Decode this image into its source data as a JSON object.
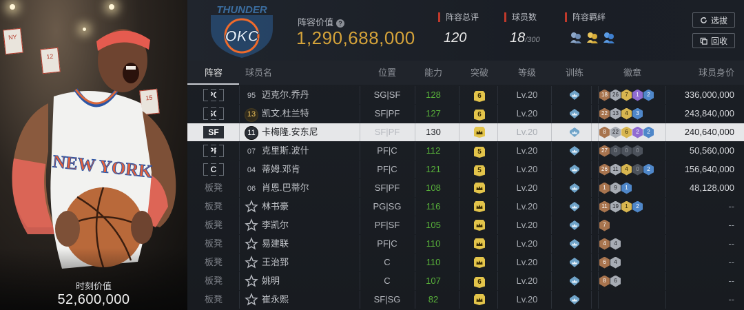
{
  "card": {
    "moment_label": "时刻价值",
    "moment_value": "52,600,000",
    "jersey_text": "NEW YORK"
  },
  "header": {
    "team_logo_text": "OKC",
    "team_logo_sub": "THUNDER",
    "lineup_value_label": "阵容价值",
    "lineup_value": "1,290,688,000",
    "rating_label": "阵容总评",
    "rating_value": "120",
    "players_label": "球员数",
    "players_value": "18",
    "players_max": "/300",
    "bond_label": "阵容羁绊",
    "select_button": "选拔",
    "recycle_button": "回收"
  },
  "columns": [
    "阵容",
    "球员名",
    "位置",
    "能力",
    "突破",
    "等级",
    "训练",
    "徽章",
    "球员身价"
  ],
  "rows": [
    {
      "slot": "PG",
      "num": "95",
      "num_style": "plain",
      "name": "迈克尔.乔丹",
      "pos": "SG|SF",
      "power": "128",
      "brk": "6",
      "lv": "Lv.20",
      "badges": [
        [
          "brown",
          "18"
        ],
        [
          "silver",
          "26"
        ],
        [
          "gold",
          "7"
        ],
        [
          "purple",
          "1"
        ],
        [
          "blue",
          "2"
        ]
      ],
      "price": "336,000,000"
    },
    {
      "slot": "SG",
      "num": "13",
      "num_style": "gold",
      "name": "凯文.杜兰特",
      "pos": "SF|PF",
      "power": "127",
      "brk": "6",
      "lv": "Lv.20",
      "badges": [
        [
          "brown",
          "22"
        ],
        [
          "silver",
          "13"
        ],
        [
          "gold",
          "4"
        ],
        [
          "blue",
          "3"
        ]
      ],
      "price": "243,840,000"
    },
    {
      "slot": "SF",
      "num": "11",
      "num_style": "dark",
      "name": "卡梅隆.安东尼",
      "pos": "SF|PF",
      "power": "130",
      "brk": "crown",
      "lv": "Lv.20",
      "badges": [
        [
          "brown",
          "8"
        ],
        [
          "silver",
          "22"
        ],
        [
          "gold",
          "6"
        ],
        [
          "purple",
          "2"
        ],
        [
          "blue",
          "2"
        ]
      ],
      "price": "240,640,000",
      "selected": true
    },
    {
      "slot": "PF",
      "num": "07",
      "num_style": "plain",
      "name": "克里斯.波什",
      "pos": "PF|C",
      "power": "112",
      "brk": "5",
      "lv": "Lv.20",
      "badges": [
        [
          "brown",
          "27"
        ],
        [
          "gray",
          "0"
        ],
        [
          "gray",
          "0"
        ],
        [
          "gray",
          "0"
        ]
      ],
      "price": "50,560,000"
    },
    {
      "slot": "C",
      "num": "04",
      "num_style": "plain",
      "name": "蒂姆.邓肯",
      "pos": "PF|C",
      "power": "121",
      "brk": "5",
      "lv": "Lv.20",
      "badges": [
        [
          "brown",
          "26"
        ],
        [
          "silver",
          "11"
        ],
        [
          "gold",
          "4"
        ],
        [
          "gray",
          "0"
        ],
        [
          "blue",
          "2"
        ]
      ],
      "price": "156,640,000"
    },
    {
      "slot": "板凳",
      "num": "06",
      "num_style": "plain",
      "name": "肖恩.巴蒂尔",
      "pos": "SF|PF",
      "power": "108",
      "brk": "crown",
      "lv": "Lv.20",
      "badges": [
        [
          "brown",
          "1"
        ],
        [
          "silver",
          "9"
        ],
        [
          "blue",
          "1"
        ]
      ],
      "price": "48,128,000"
    },
    {
      "slot": "板凳",
      "num": "",
      "num_style": "star",
      "name": "林书豪",
      "pos": "PG|SG",
      "power": "116",
      "brk": "crown",
      "lv": "Lv.20",
      "badges": [
        [
          "brown",
          "11"
        ],
        [
          "silver",
          "19"
        ],
        [
          "gold",
          "1"
        ],
        [
          "blue",
          "2"
        ]
      ],
      "price": "--"
    },
    {
      "slot": "板凳",
      "num": "",
      "num_style": "star",
      "name": "李凯尔",
      "pos": "PF|SF",
      "power": "105",
      "brk": "crown",
      "lv": "Lv.20",
      "badges": [
        [
          "brown",
          "7"
        ]
      ],
      "price": "--"
    },
    {
      "slot": "板凳",
      "num": "",
      "num_style": "star",
      "name": "易建联",
      "pos": "PF|C",
      "power": "110",
      "brk": "crown",
      "lv": "Lv.20",
      "badges": [
        [
          "brown",
          "4"
        ],
        [
          "silver",
          "4"
        ]
      ],
      "price": "--"
    },
    {
      "slot": "板凳",
      "num": "",
      "num_style": "star",
      "name": "王治郅",
      "pos": "C",
      "power": "110",
      "brk": "crown",
      "lv": "Lv.20",
      "badges": [
        [
          "brown",
          "6"
        ],
        [
          "silver",
          "4"
        ]
      ],
      "price": "--"
    },
    {
      "slot": "板凳",
      "num": "",
      "num_style": "star",
      "name": "姚明",
      "pos": "C",
      "power": "107",
      "brk": "6",
      "lv": "Lv.20",
      "badges": [
        [
          "brown",
          "8"
        ],
        [
          "silver",
          "6"
        ]
      ],
      "price": "--"
    },
    {
      "slot": "板凳",
      "num": "",
      "num_style": "star",
      "name": "崔永熙",
      "pos": "SF|SG",
      "power": "82",
      "brk": "crown",
      "lv": "Lv.20",
      "badges": [],
      "price": "--"
    }
  ],
  "colors": {
    "accent_gold": "#d5a33a",
    "power_green": "#58b13a",
    "marker_red": "#c0392b"
  },
  "icons": [
    "help-icon",
    "bond-icon",
    "refresh-icon",
    "recycle-icon",
    "star-icon",
    "crown-icon",
    "training-icon",
    "badge-hex-icon"
  ]
}
